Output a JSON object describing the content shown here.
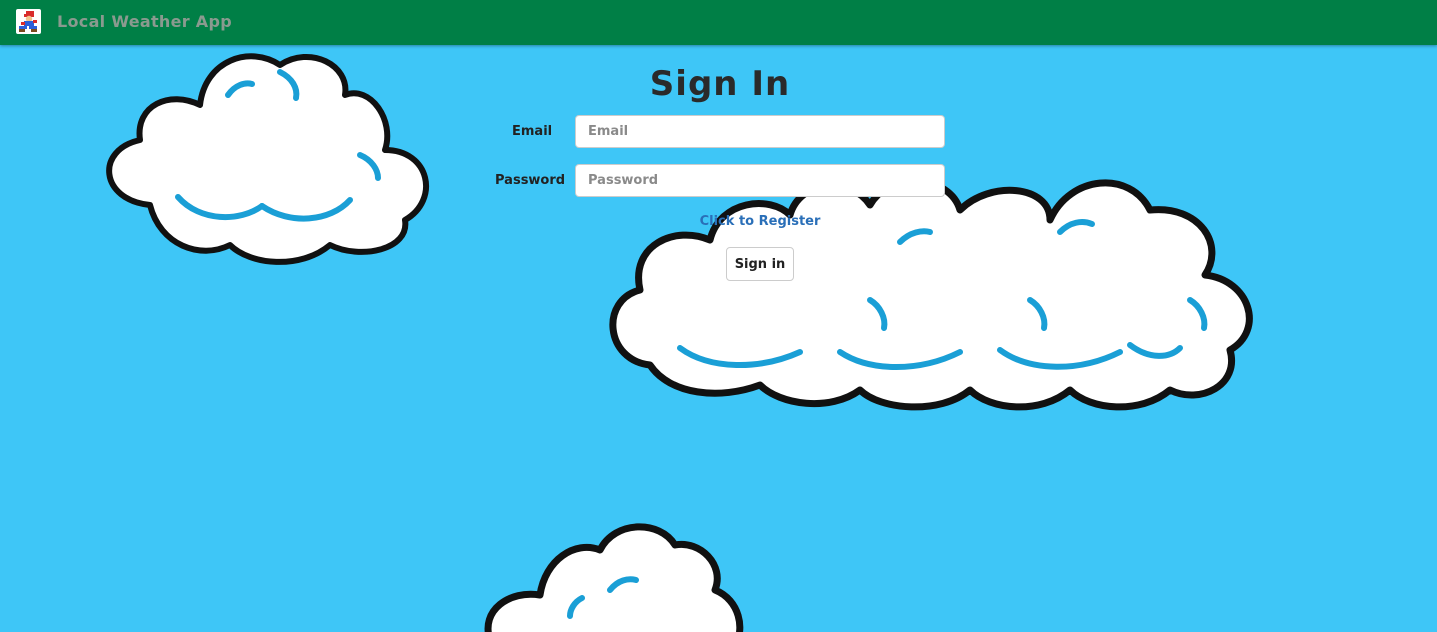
{
  "navbar": {
    "title": "Local Weather App",
    "logo_icon": "mario-character-icon"
  },
  "form": {
    "heading": "Sign In",
    "email_label": "Email",
    "email_placeholder": "Email",
    "email_value": "",
    "password_label": "Password",
    "password_placeholder": "Password",
    "password_value": "",
    "register_link": "Click to Register",
    "submit_label": "Sign in"
  },
  "colors": {
    "navbar": "#007f46",
    "sky": "#3ec6f7",
    "link": "#2a6fb8"
  }
}
